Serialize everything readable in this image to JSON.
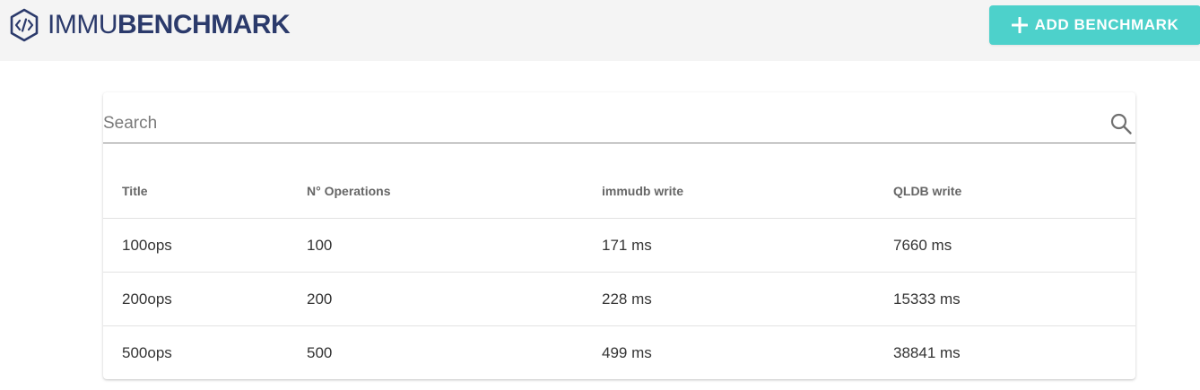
{
  "header": {
    "logo_text_light": "IMMU",
    "logo_text_bold": "BENCHMARK",
    "logo_icon": "code-hexagon-icon",
    "add_button_label": "ADD BENCHMARK",
    "add_button_icon": "plus-icon",
    "add_button_color": "#4dd1cb",
    "brand_color": "#2b3a6b"
  },
  "search": {
    "placeholder": "Search",
    "value": "",
    "icon": "search-icon"
  },
  "table": {
    "columns": [
      "Title",
      "N° Operations",
      "immudb write",
      "QLDB write"
    ],
    "rows": [
      [
        "100ops",
        "100",
        "171 ms",
        "7660 ms"
      ],
      [
        "200ops",
        "200",
        "228 ms",
        "15333 ms"
      ],
      [
        "500ops",
        "500",
        "499 ms",
        "38841 ms"
      ]
    ]
  }
}
